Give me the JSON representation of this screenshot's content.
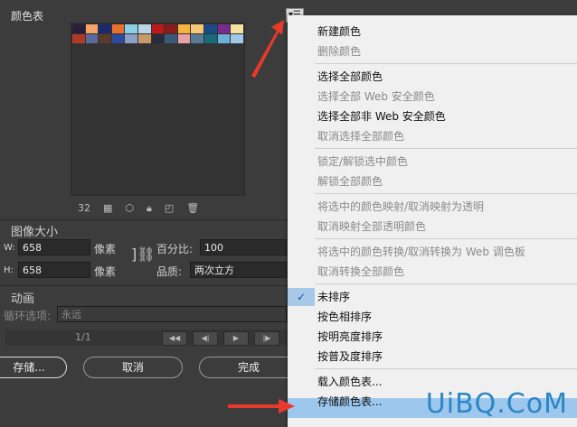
{
  "panel": {
    "title": "颜色表",
    "color_count": "32",
    "menu_button_icon": "flyout-menu-icon"
  },
  "swatch_rows": [
    [
      "#2a1f3a",
      "#f5a46a",
      "#1c2a6b",
      "#e8712b",
      "#8ad0e8",
      "#b8d6e6",
      "#c01818",
      "#8b1a1a",
      "#f5b440",
      "#f5c878",
      "#1a4a8a",
      "#7a2a8a",
      "#f5e2a0"
    ],
    [
      "#b03a24",
      "#5a6aa0",
      "#5a3a2a",
      "#2a4aa0",
      "#8aa0c8",
      "#c89a6a",
      "#2a2a3a",
      "#3a5a7a",
      "#e8a0a8",
      "#5a7a9a",
      "#1a6a7a",
      "#6ab0d8",
      "#a0c8e8"
    ]
  ],
  "image_size": {
    "title": "图像大小",
    "w_label": "W:",
    "h_label": "H:",
    "w_value": "658",
    "h_value": "658",
    "w_unit": "像素",
    "h_unit": "像素",
    "percent_label": "百分比:",
    "percent_value": "100",
    "quality_label": "品质:",
    "quality_value": "两次立方"
  },
  "animation": {
    "title": "动画",
    "loop_label": "循环选项:",
    "loop_value": "永远",
    "frame_counter": "1/1"
  },
  "buttons": {
    "save": "存储...",
    "cancel": "取消",
    "done": "完成"
  },
  "menu": {
    "groups": [
      [
        {
          "label": "新建颜色",
          "enabled": true
        },
        {
          "label": "删除颜色",
          "enabled": false
        }
      ],
      [
        {
          "label": "选择全部颜色",
          "enabled": true
        },
        {
          "label": "选择全部 Web 安全颜色",
          "enabled": false
        },
        {
          "label": "选择全部非 Web 安全颜色",
          "enabled": true
        },
        {
          "label": "取消选择全部颜色",
          "enabled": false
        }
      ],
      [
        {
          "label": "锁定/解锁选中颜色",
          "enabled": false
        },
        {
          "label": "解锁全部颜色",
          "enabled": false
        }
      ],
      [
        {
          "label": "将选中的颜色映射/取消映射为透明",
          "enabled": false
        },
        {
          "label": "取消映射全部透明颜色",
          "enabled": false
        }
      ],
      [
        {
          "label": "将选中的颜色转换/取消转换为 Web 调色板",
          "enabled": false
        },
        {
          "label": "取消转换全部颜色",
          "enabled": false
        }
      ],
      [
        {
          "label": "未排序",
          "enabled": true,
          "checked": true
        },
        {
          "label": "按色相排序",
          "enabled": true
        },
        {
          "label": "按明亮度排序",
          "enabled": true
        },
        {
          "label": "按普及度排序",
          "enabled": true
        }
      ],
      [
        {
          "label": "载入颜色表...",
          "enabled": true
        },
        {
          "label": "存储颜色表...",
          "enabled": true,
          "highlighted": true
        }
      ]
    ]
  },
  "watermark": "UiBQ.CoM",
  "colors": {
    "accent_arrow": "#e8392a",
    "menu_highlight": "#9ec7ee",
    "watermark": "#2b86c5"
  }
}
